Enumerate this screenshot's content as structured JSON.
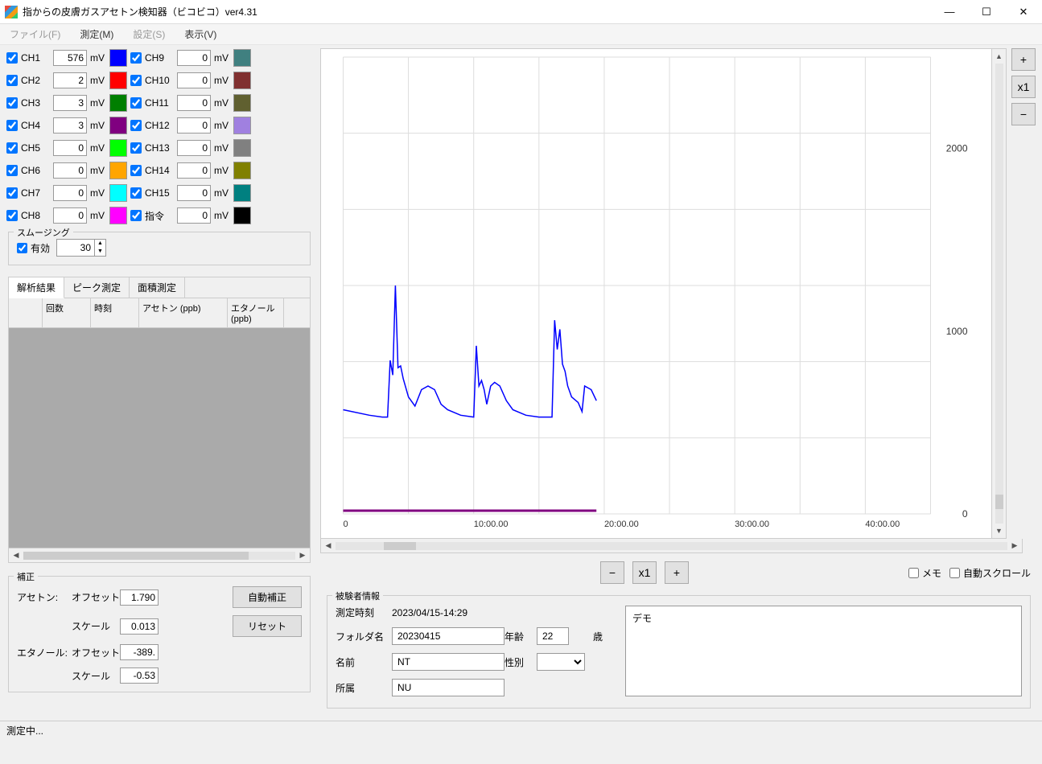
{
  "title": "指からの皮膚ガスアセトン検知器（ビコビコ）ver4.31",
  "menus": {
    "file": "ファイル(F)",
    "measure": "測定(M)",
    "settings": "設定(S)",
    "view": "表示(V)"
  },
  "channels_left": [
    {
      "label": "CH1",
      "value": "576",
      "color": "#0000ff"
    },
    {
      "label": "CH2",
      "value": "2",
      "color": "#ff0000"
    },
    {
      "label": "CH3",
      "value": "3",
      "color": "#007f00"
    },
    {
      "label": "CH4",
      "value": "3",
      "color": "#800080"
    },
    {
      "label": "CH5",
      "value": "0",
      "color": "#00ff00"
    },
    {
      "label": "CH6",
      "value": "0",
      "color": "#ffa500"
    },
    {
      "label": "CH7",
      "value": "0",
      "color": "#00ffff"
    },
    {
      "label": "CH8",
      "value": "0",
      "color": "#ff00ff"
    }
  ],
  "channels_right": [
    {
      "label": "CH9",
      "value": "0",
      "color": "#408080"
    },
    {
      "label": "CH10",
      "value": "0",
      "color": "#803030"
    },
    {
      "label": "CH11",
      "value": "0",
      "color": "#606030"
    },
    {
      "label": "CH12",
      "value": "0",
      "color": "#a080e0"
    },
    {
      "label": "CH13",
      "value": "0",
      "color": "#808080"
    },
    {
      "label": "CH14",
      "value": "0",
      "color": "#808000"
    },
    {
      "label": "CH15",
      "value": "0",
      "color": "#008080"
    },
    {
      "label": "指令",
      "value": "0",
      "color": "#000000"
    }
  ],
  "unit": "mV",
  "smoothing": {
    "title": "スムージング",
    "enable": "有効",
    "value": "30"
  },
  "tabs": {
    "analysis": "解析結果",
    "peak": "ピーク測定",
    "area": "面積測定"
  },
  "table": {
    "col1": "回数",
    "col2": "時刻",
    "col3": "アセトン (ppb)",
    "col4": "エタノール (ppb)"
  },
  "correction": {
    "title": "補正",
    "acetone": "アセトン:",
    "ethanol": "エタノール:",
    "offset": "オフセット",
    "scale": "スケール",
    "auto": "自動補正",
    "reset": "リセット",
    "ac_off": "1.790",
    "ac_scale": "0.013",
    "et_off": "-389.",
    "et_scale": "-0.53"
  },
  "chart_ctrl": {
    "minus": "−",
    "x1": "x1",
    "plus": "+",
    "memo": "メモ",
    "autoscroll": "自動スクロール"
  },
  "subject": {
    "title": "被験者情報",
    "time_lbl": "測定時刻",
    "time_val": "2023/04/15-14:29",
    "folder_lbl": "フォルダ名",
    "folder_val": "20230415",
    "name_lbl": "名前",
    "name_val": "NT",
    "affil_lbl": "所属",
    "affil_val": "NU",
    "age_lbl": "年齢",
    "age_val": "22",
    "age_unit": "歳",
    "sex_lbl": "性別",
    "memo": "デモ"
  },
  "status": "測定中...",
  "chart_data": {
    "type": "line",
    "title": "",
    "xlabel": "",
    "ylabel": "",
    "ylim": [
      0,
      2500
    ],
    "xticks": [
      "0",
      "10:00.00",
      "20:00.00",
      "30:00.00",
      "40:00.00"
    ],
    "yticks": [
      0,
      1000,
      2000
    ],
    "series": [
      {
        "name": "CH1",
        "color": "#0000ff",
        "x": [
          0,
          2,
          3,
          3.4,
          3.6,
          3.8,
          4,
          4.2,
          4.4,
          4.6,
          5,
          5.5,
          6,
          6.5,
          7,
          7.5,
          8,
          9,
          10,
          10.2,
          10.4,
          10.6,
          10.8,
          11,
          11.3,
          11.6,
          12,
          12.5,
          13,
          14,
          15,
          16,
          16.2,
          16.4,
          16.6,
          16.8,
          17,
          17.2,
          17.5,
          18,
          18.3,
          18.5,
          19,
          19.4
        ],
        "y": [
          570,
          540,
          530,
          530,
          840,
          760,
          1250,
          800,
          810,
          740,
          640,
          590,
          680,
          700,
          680,
          600,
          570,
          540,
          530,
          920,
          700,
          730,
          680,
          600,
          700,
          720,
          700,
          620,
          570,
          540,
          530,
          530,
          1060,
          900,
          1010,
          820,
          780,
          700,
          640,
          610,
          560,
          700,
          680,
          620
        ]
      }
    ]
  }
}
